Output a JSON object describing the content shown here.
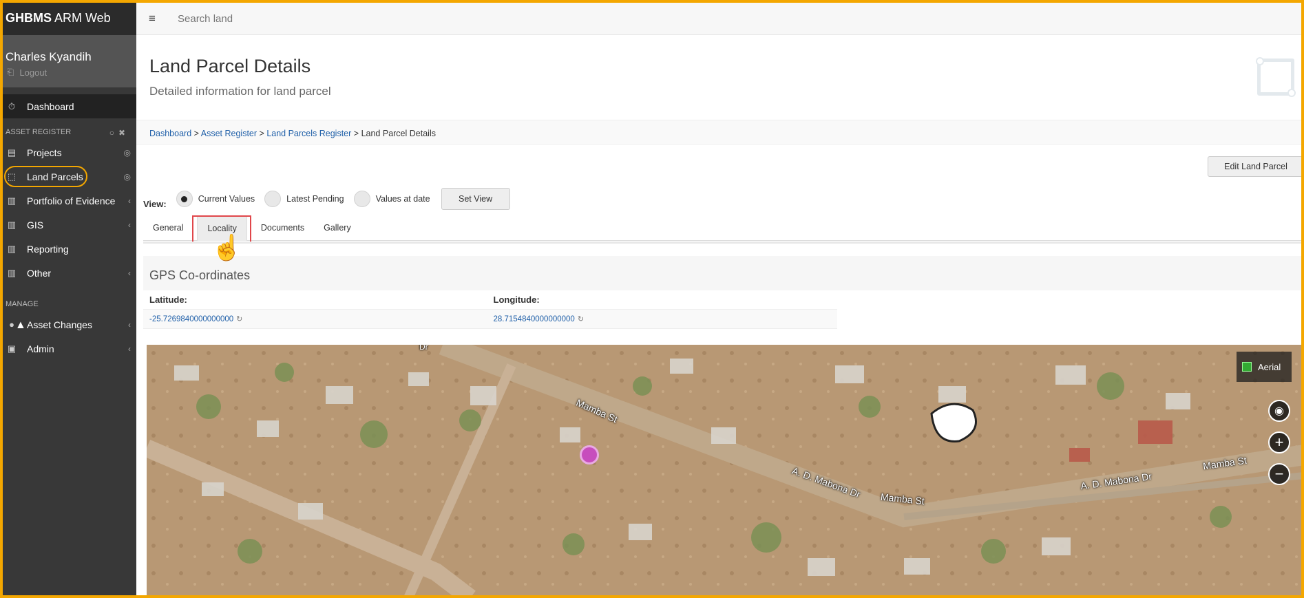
{
  "app": {
    "brand_bold": "GHBMS",
    "brand_rest": " ARM Web"
  },
  "user": {
    "name": "Charles Kyandih",
    "logout": "Logout"
  },
  "sidebar": {
    "dashboard": "Dashboard",
    "asset_section": "ASSET REGISTER",
    "items": [
      {
        "label": "Projects",
        "icon": "building-icon",
        "right": "globe-icon"
      },
      {
        "label": "Land Parcels",
        "icon": "parcel-icon",
        "right": "globe-icon"
      },
      {
        "label": "Portfolio of Evidence",
        "icon": "book-icon",
        "right": "chevron-left-icon"
      },
      {
        "label": "GIS",
        "icon": "book-icon",
        "right": "chevron-left-icon"
      },
      {
        "label": "Reporting",
        "icon": "book-icon",
        "right": ""
      },
      {
        "label": "Other",
        "icon": "book-icon",
        "right": "chevron-left-icon"
      }
    ],
    "manage_section": "MANAGE",
    "manage_items": [
      {
        "label": "Asset Changes",
        "icon": "user-icon",
        "right": "chevron-left-icon"
      },
      {
        "label": "Admin",
        "icon": "clipboard-icon",
        "right": "chevron-left-icon"
      }
    ]
  },
  "topbar": {
    "search_placeholder": "Search land"
  },
  "page": {
    "title": "Land Parcel Details",
    "subtitle": "Detailed information for land parcel"
  },
  "breadcrumb": {
    "items": [
      "Dashboard",
      "Asset Register",
      "Land Parcels Register"
    ],
    "current": "Land Parcel Details",
    "separator": ">"
  },
  "actions": {
    "edit": "Edit Land Parcel"
  },
  "view": {
    "label": "View:",
    "options": [
      "Current Values",
      "Latest Pending",
      "Values at date"
    ],
    "selected": 0,
    "set_button": "Set View"
  },
  "tabs": [
    "General",
    "Locality",
    "Documents",
    "Gallery"
  ],
  "active_tab": "Locality",
  "gps": {
    "heading": "GPS Co-ordinates",
    "lat_label": "Latitude:",
    "lon_label": "Longitude:",
    "lat_value": "-25.7269840000000000",
    "lon_value": "28.7154840000000000"
  },
  "map": {
    "layer": "Aerial",
    "streets": [
      "Mamba St",
      "A. D. Mabona Dr",
      "Mamba St",
      "A. D. Mabona Dr",
      "Mamba St",
      "Dr"
    ],
    "marker_color": "#c74dbd"
  },
  "colors": {
    "highlight": "#f4a700",
    "tab_highlight": "#e0464a",
    "link": "#1f5fa8"
  }
}
